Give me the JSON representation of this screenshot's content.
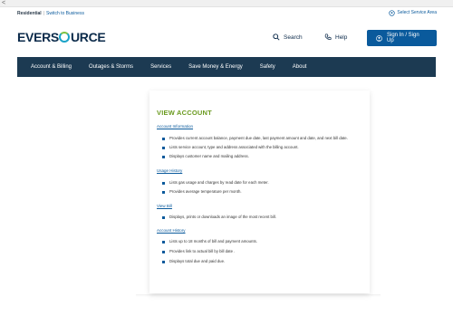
{
  "top_strip": {
    "back_glyph": "<"
  },
  "utility": {
    "residential": "Residential",
    "separator": "|",
    "switch_business": "Switch to Business",
    "service_area": "Select Service Area",
    "service_area_icon": "location-pin-icon"
  },
  "header": {
    "logo_part1": "EVERS",
    "logo_part2": "URCE",
    "search_label": "Search",
    "help_label": "Help",
    "signin_label": "Sign In / Sign Up"
  },
  "nav": {
    "items": [
      {
        "label": "Account & Billing"
      },
      {
        "label": "Outages & Storms"
      },
      {
        "label": "Services"
      },
      {
        "label": "Save Money & Energy"
      },
      {
        "label": "Safety"
      },
      {
        "label": "About"
      }
    ]
  },
  "content": {
    "title": "VIEW ACCOUNT",
    "sections": [
      {
        "link": "Account Information",
        "bullets": [
          "Provides current account balance, payment due date, last payment amount and date, and next bill date.",
          "Lists service account, type and address associated with the billing account.",
          "Displays customer name and mailing address."
        ]
      },
      {
        "link": "Usage History",
        "bullets": [
          "Lists gas usage and charges by read date for each meter.",
          "Provides average temperature per month."
        ]
      },
      {
        "link": "View Bill",
        "bullets": [
          "Displays, prints or downloads an image of the most recent bill."
        ]
      },
      {
        "link": "Account History",
        "bullets": [
          "Lists up to 18 months of bill and payment amounts.",
          "Provides link to actual bill by bill date .",
          "Displays total due and paid due."
        ]
      }
    ]
  },
  "colors": {
    "navbar": "#1c3a52",
    "accent_blue": "#0a5a9c",
    "title_green": "#6a9a1f"
  }
}
